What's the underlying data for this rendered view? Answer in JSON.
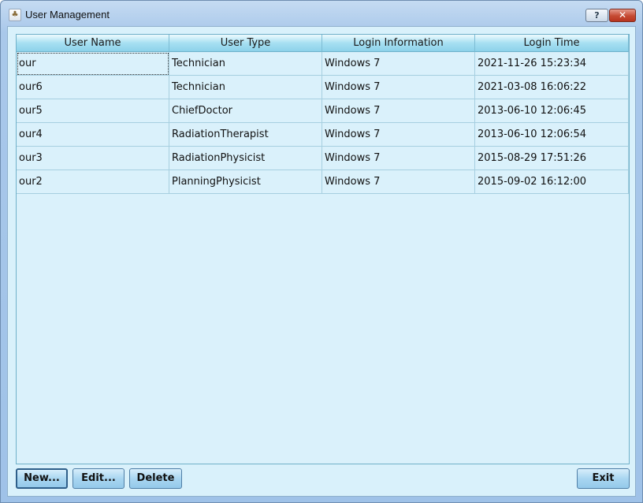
{
  "window": {
    "title": "User Management",
    "icon": "app-icon",
    "help_label": "?",
    "close_label": "✕"
  },
  "table": {
    "columns": [
      "User Name",
      "User Type",
      "Login Information",
      "Login Time"
    ],
    "rows": [
      [
        "our",
        "Technician",
        "Windows 7",
        "2021-11-26 15:23:34"
      ],
      [
        "our6",
        "Technician",
        "Windows 7",
        "2021-03-08 16:06:22"
      ],
      [
        "our5",
        "ChiefDoctor",
        "Windows 7",
        "2013-06-10 12:06:45"
      ],
      [
        "our4",
        "RadiationTherapist",
        "Windows 7",
        "2013-06-10 12:06:54"
      ],
      [
        "our3",
        "RadiationPhysicist",
        "Windows 7",
        "2015-08-29 17:51:26"
      ],
      [
        "our2",
        "PlanningPhysicist",
        "Windows 7",
        "2015-09-02 16:12:00"
      ]
    ]
  },
  "buttons": {
    "new": "New...",
    "edit": "Edit...",
    "delete": "Delete",
    "exit": "Exit"
  },
  "colors": {
    "header_bg": "#a7e0f2",
    "body_bg": "#daf1fb",
    "close_button": "#c54a33"
  }
}
